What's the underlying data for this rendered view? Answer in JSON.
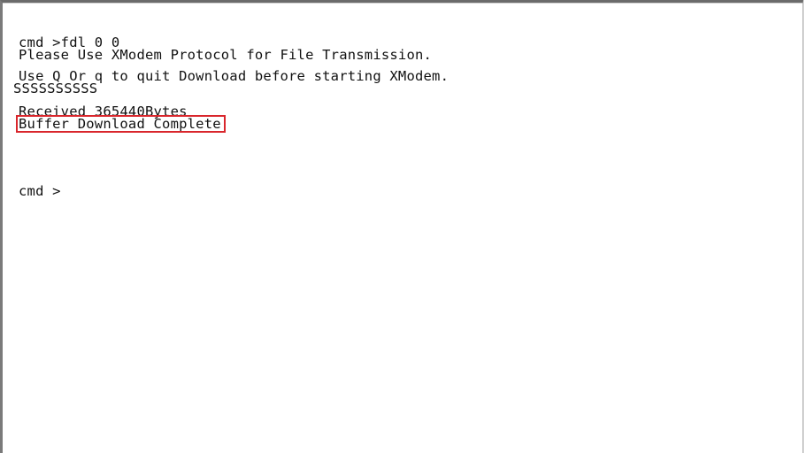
{
  "terminal": {
    "lines": {
      "command": "cmd >fdl 0 0",
      "protocol_notice": "Please Use XModem Protocol for File Transmission.",
      "quit_notice": "Use Q Or q to quit Download before starting XModem.",
      "progress_marks": "SSSSSSSSSS",
      "received": "Received 365440Bytes",
      "complete": "Buffer Download Complete",
      "prompt": "cmd >"
    },
    "highlight_color": "#d9262c"
  }
}
